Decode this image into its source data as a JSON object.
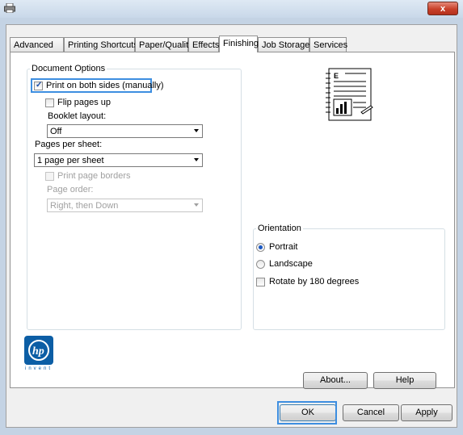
{
  "window": {
    "close_label": "x"
  },
  "tabs": [
    {
      "label": "Advanced"
    },
    {
      "label": "Printing Shortcuts"
    },
    {
      "label": "Paper/Quality"
    },
    {
      "label": "Effects"
    },
    {
      "label": "Finishing"
    },
    {
      "label": "Job Storage"
    },
    {
      "label": "Services"
    }
  ],
  "active_tab": "Finishing",
  "document_options": {
    "caption": "Document Options",
    "print_both_sides": {
      "label": "Print on both sides (manually)",
      "checked": true
    },
    "flip_pages_up": {
      "label": "Flip pages up",
      "checked": false
    },
    "booklet_layout_label": "Booklet layout:",
    "booklet_layout_value": "Off",
    "pages_per_sheet_label": "Pages per sheet:",
    "pages_per_sheet_value": "1 page per sheet",
    "print_page_borders": {
      "label": "Print page borders",
      "checked": false,
      "enabled": false
    },
    "page_order_label": "Page order:",
    "page_order_value": "Right, then Down"
  },
  "orientation": {
    "caption": "Orientation",
    "options": [
      {
        "label": "Portrait",
        "selected": true
      },
      {
        "label": "Landscape",
        "selected": false
      }
    ],
    "rotate_180": {
      "label": "Rotate by 180 degrees",
      "checked": false
    }
  },
  "preview": {
    "icon": "document-preview-icon",
    "letter": "E"
  },
  "brand": {
    "logo_text": "hp",
    "tagline": "invent",
    "color": "#0c5ea5"
  },
  "buttons": {
    "about": "About...",
    "help": "Help",
    "ok": "OK",
    "cancel": "Cancel",
    "apply": "Apply"
  }
}
